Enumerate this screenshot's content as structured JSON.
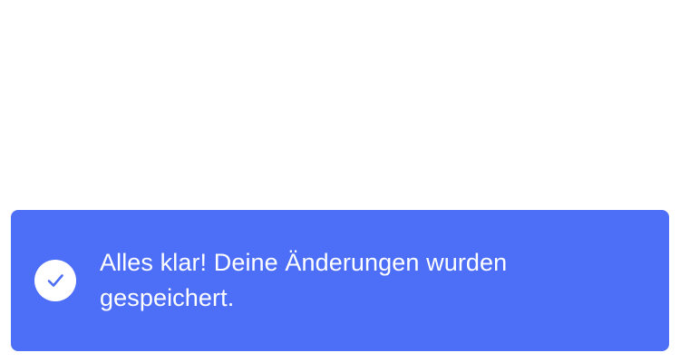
{
  "toast": {
    "icon": "check-circle-icon",
    "message": "Alles klar! Deine Änderungen wurden gespeichert.",
    "background_color": "#4d6ef7",
    "icon_check_color": "#4d6ef7",
    "text_color": "#ffffff"
  }
}
